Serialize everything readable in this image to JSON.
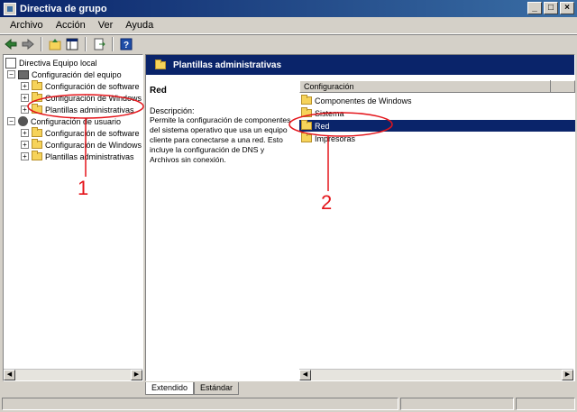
{
  "window": {
    "title": "Directiva de grupo"
  },
  "menubar": {
    "items": [
      "Archivo",
      "Acción",
      "Ver",
      "Ayuda"
    ]
  },
  "toolbar": {
    "buttons": [
      "back-icon",
      "forward-icon",
      "up-icon",
      "show-hide-tree-icon",
      "export-list-icon",
      "help-icon"
    ]
  },
  "tree": {
    "root": "Directiva Equipo local",
    "computer": {
      "label": "Configuración del equipo",
      "children": [
        "Configuración de software",
        "Configuración de Windows",
        "Plantillas administrativas"
      ]
    },
    "user": {
      "label": "Configuración de usuario",
      "children": [
        "Configuración de software",
        "Configuración de Windows",
        "Plantillas administrativas"
      ]
    }
  },
  "right": {
    "header": "Plantillas administrativas",
    "description_title": "Red",
    "description_label": "Descripción:",
    "description_text": "Permite la configuración de componentes del sistema operativo que usa un equipo cliente para conectarse a una red. Esto incluye la configuración de DNS y Archivos sin conexión.",
    "column_header": "Configuración",
    "items": [
      "Componentes de Windows",
      "Sistema",
      "Red",
      "Impresoras"
    ],
    "selected_index": 2
  },
  "tabs": [
    "Extendido",
    "Estándar"
  ],
  "annotations": {
    "label_1": "1",
    "label_2": "2",
    "color": "#e4141a"
  },
  "colors": {
    "accent": "#0a246a",
    "chrome": "#d4d0c8"
  }
}
